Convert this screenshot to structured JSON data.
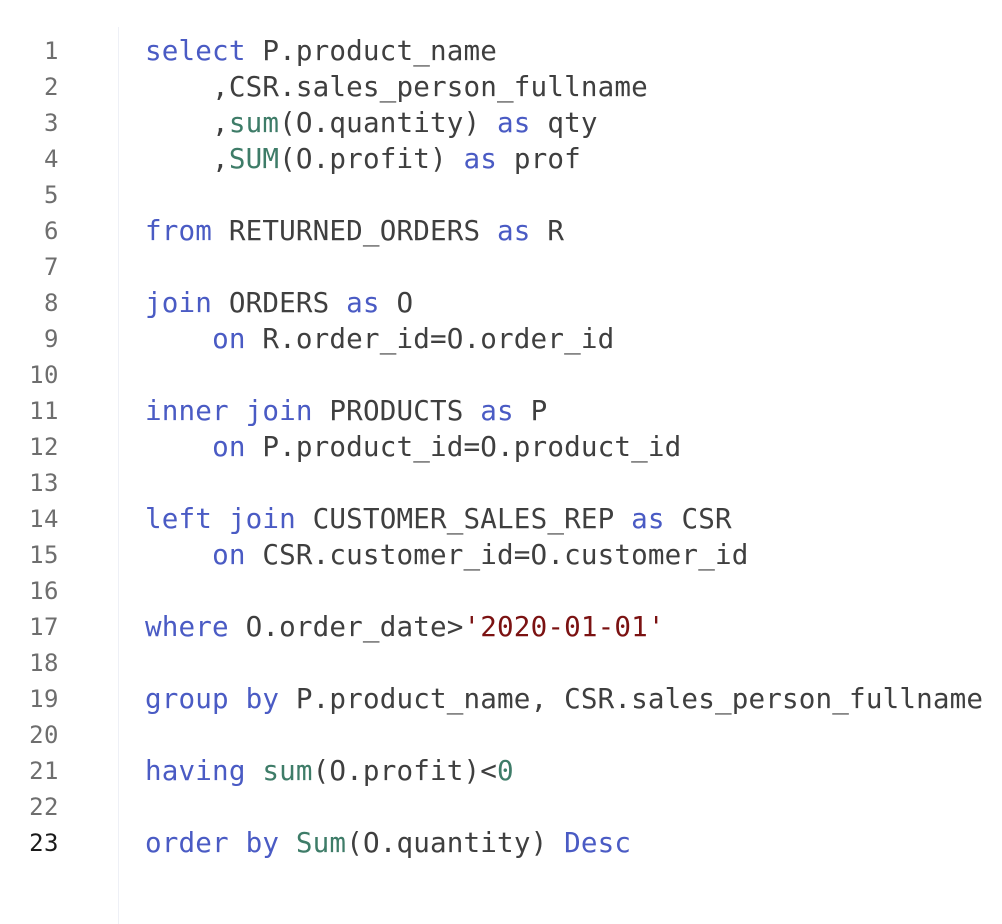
{
  "editor": {
    "language": "sql",
    "active_line": 23,
    "colors": {
      "keyword": "#4a5bc4",
      "function": "#3e7c68",
      "string": "#7b1212",
      "number": "#3e7c68",
      "plain": "#3f3f3f",
      "line_number": "#6e6e6e",
      "line_number_active": "#1a1a1a",
      "background": "#ffffff"
    },
    "lines": [
      {
        "number": "1",
        "tokens": [
          {
            "type": "keyword",
            "text": "select"
          },
          {
            "type": "plain",
            "text": " P.product_name"
          }
        ]
      },
      {
        "number": "2",
        "tokens": [
          {
            "type": "plain",
            "text": "    ,CSR.sales_person_fullname"
          }
        ]
      },
      {
        "number": "3",
        "tokens": [
          {
            "type": "plain",
            "text": "    ,"
          },
          {
            "type": "function",
            "text": "sum"
          },
          {
            "type": "plain",
            "text": "(O.quantity) "
          },
          {
            "type": "keyword",
            "text": "as"
          },
          {
            "type": "plain",
            "text": " qty"
          }
        ]
      },
      {
        "number": "4",
        "tokens": [
          {
            "type": "plain",
            "text": "    ,"
          },
          {
            "type": "function",
            "text": "SUM"
          },
          {
            "type": "plain",
            "text": "(O.profit) "
          },
          {
            "type": "keyword",
            "text": "as"
          },
          {
            "type": "plain",
            "text": " prof"
          }
        ]
      },
      {
        "number": "5",
        "tokens": []
      },
      {
        "number": "6",
        "tokens": [
          {
            "type": "keyword",
            "text": "from"
          },
          {
            "type": "plain",
            "text": " RETURNED_ORDERS "
          },
          {
            "type": "keyword",
            "text": "as"
          },
          {
            "type": "plain",
            "text": " R"
          }
        ]
      },
      {
        "number": "7",
        "tokens": []
      },
      {
        "number": "8",
        "tokens": [
          {
            "type": "keyword",
            "text": "join"
          },
          {
            "type": "plain",
            "text": " ORDERS "
          },
          {
            "type": "keyword",
            "text": "as"
          },
          {
            "type": "plain",
            "text": " O"
          }
        ]
      },
      {
        "number": "9",
        "tokens": [
          {
            "type": "plain",
            "text": "    "
          },
          {
            "type": "keyword",
            "text": "on"
          },
          {
            "type": "plain",
            "text": " R.order_id=O.order_id"
          }
        ]
      },
      {
        "number": "10",
        "tokens": []
      },
      {
        "number": "11",
        "tokens": [
          {
            "type": "keyword",
            "text": "inner"
          },
          {
            "type": "plain",
            "text": " "
          },
          {
            "type": "keyword",
            "text": "join"
          },
          {
            "type": "plain",
            "text": " PRODUCTS "
          },
          {
            "type": "keyword",
            "text": "as"
          },
          {
            "type": "plain",
            "text": " P"
          }
        ]
      },
      {
        "number": "12",
        "tokens": [
          {
            "type": "plain",
            "text": "    "
          },
          {
            "type": "keyword",
            "text": "on"
          },
          {
            "type": "plain",
            "text": " P.product_id=O.product_id"
          }
        ]
      },
      {
        "number": "13",
        "tokens": []
      },
      {
        "number": "14",
        "tokens": [
          {
            "type": "keyword",
            "text": "left"
          },
          {
            "type": "plain",
            "text": " "
          },
          {
            "type": "keyword",
            "text": "join"
          },
          {
            "type": "plain",
            "text": " CUSTOMER_SALES_REP "
          },
          {
            "type": "keyword",
            "text": "as"
          },
          {
            "type": "plain",
            "text": " CSR"
          }
        ]
      },
      {
        "number": "15",
        "tokens": [
          {
            "type": "plain",
            "text": "    "
          },
          {
            "type": "keyword",
            "text": "on"
          },
          {
            "type": "plain",
            "text": " CSR.customer_id=O.customer_id"
          }
        ]
      },
      {
        "number": "16",
        "tokens": []
      },
      {
        "number": "17",
        "tokens": [
          {
            "type": "keyword",
            "text": "where"
          },
          {
            "type": "plain",
            "text": " O.order_date>"
          },
          {
            "type": "string",
            "text": "'2020-01-01'"
          }
        ]
      },
      {
        "number": "18",
        "tokens": []
      },
      {
        "number": "19",
        "tokens": [
          {
            "type": "keyword",
            "text": "group"
          },
          {
            "type": "plain",
            "text": " "
          },
          {
            "type": "keyword",
            "text": "by"
          },
          {
            "type": "plain",
            "text": " P.product_name, CSR.sales_person_fullname"
          }
        ]
      },
      {
        "number": "20",
        "tokens": []
      },
      {
        "number": "21",
        "tokens": [
          {
            "type": "keyword",
            "text": "having"
          },
          {
            "type": "plain",
            "text": " "
          },
          {
            "type": "function",
            "text": "sum"
          },
          {
            "type": "plain",
            "text": "(O.profit)<"
          },
          {
            "type": "number",
            "text": "0"
          }
        ]
      },
      {
        "number": "22",
        "tokens": []
      },
      {
        "number": "23",
        "tokens": [
          {
            "type": "keyword",
            "text": "order"
          },
          {
            "type": "plain",
            "text": " "
          },
          {
            "type": "keyword",
            "text": "by"
          },
          {
            "type": "plain",
            "text": " "
          },
          {
            "type": "function",
            "text": "Sum"
          },
          {
            "type": "plain",
            "text": "(O.quantity) "
          },
          {
            "type": "keyword",
            "text": "Desc"
          }
        ]
      }
    ]
  }
}
